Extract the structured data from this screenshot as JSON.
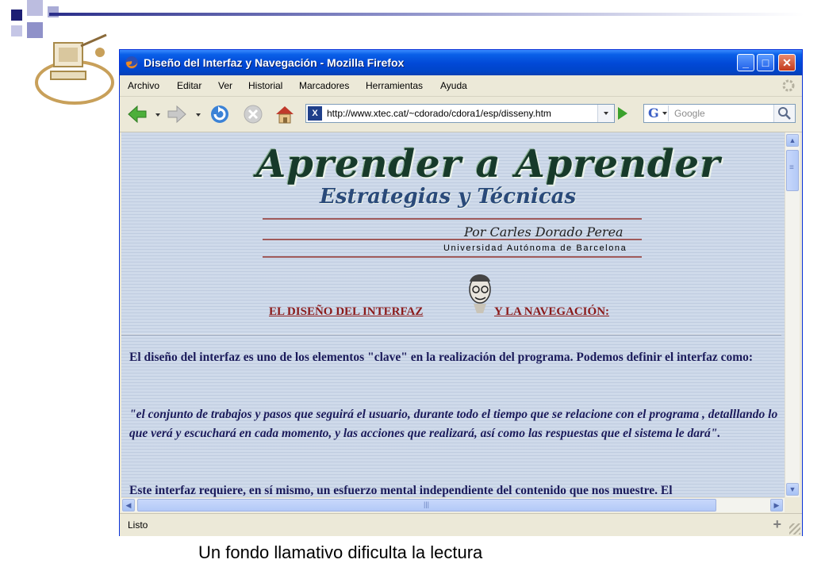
{
  "window": {
    "title": "Diseño del Interfaz y Navegación - Mozilla Firefox",
    "min_label": "_",
    "max_label": "□",
    "close_label": "✕"
  },
  "menu": {
    "items": [
      "Archivo",
      "Editar",
      "Ver",
      "Historial",
      "Marcadores",
      "Herramientas",
      "Ayuda"
    ]
  },
  "toolbar": {
    "url": "http://www.xtec.cat/~cdorado/cdora1/esp/disseny.htm",
    "site_icon_label": "X",
    "search_engine_label": "G",
    "search_placeholder": "Google",
    "icons": [
      "back-icon",
      "forward-icon",
      "reload-icon",
      "stop-icon",
      "home-icon",
      "go-icon",
      "search-icon"
    ]
  },
  "page": {
    "logo_title": "Aprender a Aprender",
    "logo_subtitle": "Estrategias y Técnicas",
    "author": "Por Carles Dorado Perea",
    "university": "Universidad Autónoma de Barcelona",
    "heading_left": "EL DISEÑO DEL INTERFAZ",
    "heading_right": "Y LA NAVEGACIÓN:",
    "paragraphs": [
      "El diseño del interfaz es uno de los elementos \"clave\" en la realización del programa. Podemos definir el interfaz como:",
      "\"el conjunto de trabajos y pasos que seguirá el usuario, durante todo el tiempo que se relacione con el programa , detalllando lo que verá y escuchará en cada momento, y las acciones que realizará, así como las respuestas que el sistema le dará\".",
      "Este interfaz requiere, en sí mismo, un esfuerzo mental independiente del contenido que nos muestre. El"
    ]
  },
  "status": {
    "text": "Listo",
    "plus": "+"
  },
  "scroll": {
    "hthumb_grip": "|||",
    "vthumb_grip": "≡"
  },
  "caption": "Un fondo llamativo dificulta la lectura",
  "colors": {
    "titlebar": "#0148d6",
    "heading": "#8a1a1a",
    "text": "#1a1a5a",
    "page_bg": "#cfdaea"
  }
}
